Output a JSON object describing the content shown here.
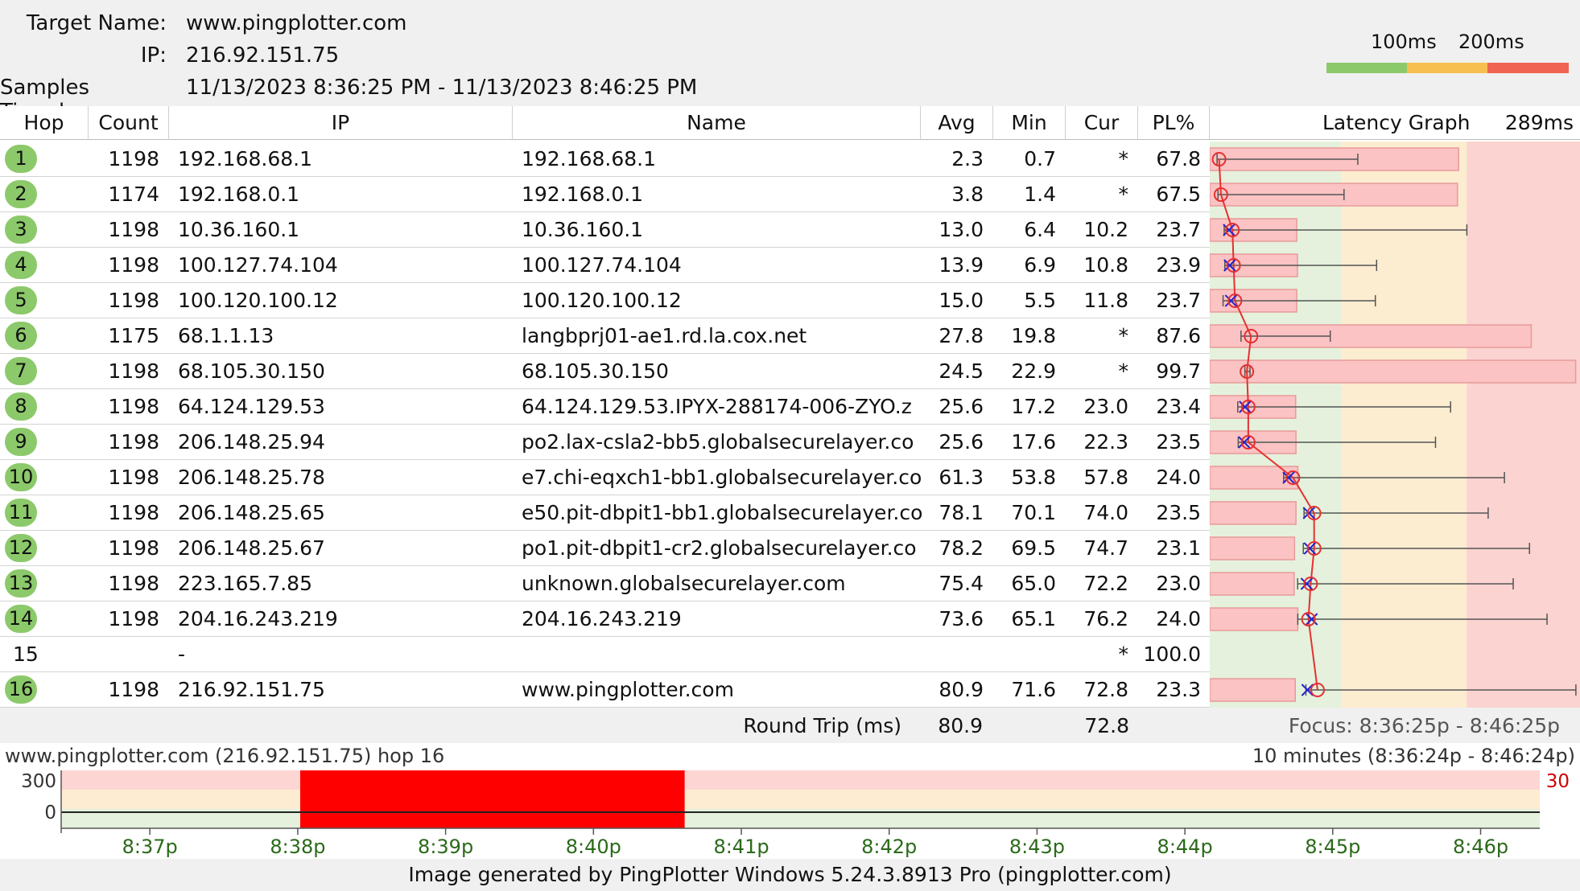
{
  "header": {
    "target_name_label": "Target Name:",
    "target_name": "www.pingplotter.com",
    "ip_label": "IP:",
    "ip": "216.92.151.75",
    "samples_label": "Samples Timed:",
    "samples": "11/13/2023 8:36:25 PM - 11/13/2023 8:46:25 PM",
    "scale_100": "100ms",
    "scale_200": "200ms",
    "scale_colors": [
      "#8cc96a",
      "#f7bf4f",
      "#f06352"
    ]
  },
  "columns": {
    "hop": "Hop",
    "count": "Count",
    "ip": "IP",
    "name": "Name",
    "avg": "Avg",
    "min": "Min",
    "cur": "Cur",
    "pl": "PL%",
    "graph": "Latency Graph",
    "graph_max": "289ms"
  },
  "graph_scale_max_ms": 289,
  "hops": [
    {
      "hop": "1",
      "count": "1198",
      "ip": "192.168.68.1",
      "name": "192.168.68.1",
      "avg": "2.3",
      "min": "0.7",
      "cur": "*",
      "pl": "67.8",
      "max_ms": 113,
      "cur_ms": null
    },
    {
      "hop": "2",
      "count": "1174",
      "ip": "192.168.0.1",
      "name": "192.168.0.1",
      "avg": "3.8",
      "min": "1.4",
      "cur": "*",
      "pl": "67.5",
      "max_ms": 102,
      "cur_ms": null
    },
    {
      "hop": "3",
      "count": "1198",
      "ip": "10.36.160.1",
      "name": "10.36.160.1",
      "avg": "13.0",
      "min": "6.4",
      "cur": "10.2",
      "pl": "23.7",
      "max_ms": 200,
      "cur_ms": 10.2
    },
    {
      "hop": "4",
      "count": "1198",
      "ip": "100.127.74.104",
      "name": "100.127.74.104",
      "avg": "13.9",
      "min": "6.9",
      "cur": "10.8",
      "pl": "23.9",
      "max_ms": 128,
      "cur_ms": 10.8
    },
    {
      "hop": "5",
      "count": "1198",
      "ip": "100.120.100.12",
      "name": "100.120.100.12",
      "avg": "15.0",
      "min": "5.5",
      "cur": "11.8",
      "pl": "23.7",
      "max_ms": 127,
      "cur_ms": 11.8
    },
    {
      "hop": "6",
      "count": "1175",
      "ip": "68.1.1.13",
      "name": "langbprj01-ae1.rd.la.cox.net",
      "avg": "27.8",
      "min": "19.8",
      "cur": "*",
      "pl": "87.6",
      "max_ms": 91,
      "cur_ms": null
    },
    {
      "hop": "7",
      "count": "1198",
      "ip": "68.105.30.150",
      "name": "68.105.30.150",
      "avg": "24.5",
      "min": "22.9",
      "cur": "*",
      "pl": "99.7",
      "max_ms": 27,
      "cur_ms": null
    },
    {
      "hop": "8",
      "count": "1198",
      "ip": "64.124.129.53",
      "name": "64.124.129.53.IPYX-288174-006-ZYO.z",
      "avg": "25.6",
      "min": "17.2",
      "cur": "23.0",
      "pl": "23.4",
      "max_ms": 187,
      "cur_ms": 23.0
    },
    {
      "hop": "9",
      "count": "1198",
      "ip": "206.148.25.94",
      "name": "po2.lax-csla2-bb5.globalsecurelayer.co",
      "avg": "25.6",
      "min": "17.6",
      "cur": "22.3",
      "pl": "23.5",
      "max_ms": 175,
      "cur_ms": 22.3
    },
    {
      "hop": "10",
      "count": "1198",
      "ip": "206.148.25.78",
      "name": "e7.chi-eqxch1-bb1.globalsecurelayer.co",
      "avg": "61.3",
      "min": "53.8",
      "cur": "57.8",
      "pl": "24.0",
      "max_ms": 230,
      "cur_ms": 57.8
    },
    {
      "hop": "11",
      "count": "1198",
      "ip": "206.148.25.65",
      "name": "e50.pit-dbpit1-bb1.globalsecurelayer.co",
      "avg": "78.1",
      "min": "70.1",
      "cur": "74.0",
      "pl": "23.5",
      "max_ms": 217,
      "cur_ms": 74.0
    },
    {
      "hop": "12",
      "count": "1198",
      "ip": "206.148.25.67",
      "name": "po1.pit-dbpit1-cr2.globalsecurelayer.co",
      "avg": "78.2",
      "min": "69.5",
      "cur": "74.7",
      "pl": "23.1",
      "max_ms": 250,
      "cur_ms": 74.7
    },
    {
      "hop": "13",
      "count": "1198",
      "ip": "223.165.7.85",
      "name": "unknown.globalsecurelayer.com",
      "avg": "75.4",
      "min": "65.0",
      "cur": "72.2",
      "pl": "23.0",
      "max_ms": 237,
      "cur_ms": 72.2
    },
    {
      "hop": "14",
      "count": "1198",
      "ip": "204.16.243.219",
      "name": "204.16.243.219",
      "avg": "73.6",
      "min": "65.1",
      "cur": "76.2",
      "pl": "24.0",
      "max_ms": 264,
      "cur_ms": 76.2
    },
    {
      "hop": "15",
      "count": "",
      "ip": "-",
      "name": "",
      "avg": "",
      "min": "",
      "cur": "*",
      "pl": "100.0",
      "max_ms": null,
      "cur_ms": null
    },
    {
      "hop": "16",
      "count": "1198",
      "ip": "216.92.151.75",
      "name": "www.pingplotter.com",
      "avg": "80.9",
      "min": "71.6",
      "cur": "72.8",
      "pl": "23.3",
      "max_ms": 287,
      "cur_ms": 72.8
    }
  ],
  "roundtrip": {
    "label": "Round Trip (ms)",
    "avg": "80.9",
    "cur": "72.8",
    "focus": "Focus: 8:36:25p - 8:46:25p"
  },
  "timeline": {
    "title": "www.pingplotter.com (216.92.151.75) hop 16",
    "duration": "10 minutes (8:36:24p - 8:46:24p)",
    "y_top": "300",
    "y_bottom": "0",
    "pl_scale": "30",
    "ticks": [
      "8:37p",
      "8:38p",
      "8:39p",
      "8:40p",
      "8:41p",
      "8:42p",
      "8:43p",
      "8:44p",
      "8:45p",
      "8:46p"
    ],
    "loss_window": [
      "8:38:01p",
      "8:40:37p"
    ]
  },
  "footer": "Image generated by PingPlotter Windows 5.24.3.8913 Pro (pingplotter.com)"
}
